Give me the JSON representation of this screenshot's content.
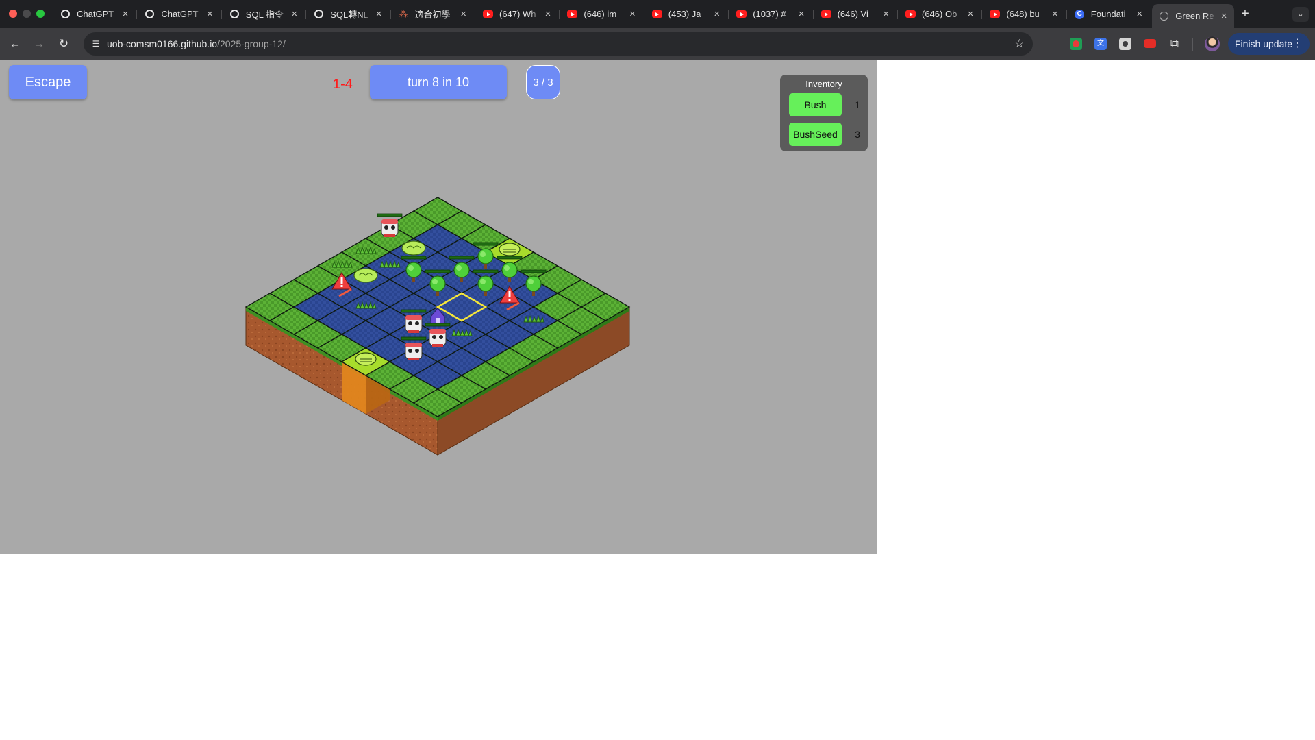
{
  "browser": {
    "tabs": [
      {
        "title": "ChatGPT",
        "icon": "chatgpt-icon"
      },
      {
        "title": "ChatGPT",
        "icon": "chatgpt-icon"
      },
      {
        "title": "SQL 指令",
        "icon": "chatgpt-icon"
      },
      {
        "title": "SQL轉NL",
        "icon": "chatgpt-icon"
      },
      {
        "title": "適合初學",
        "icon": "dots-icon"
      },
      {
        "title": "(647) Wh",
        "icon": "youtube-icon"
      },
      {
        "title": "(646) im",
        "icon": "youtube-icon"
      },
      {
        "title": "(453) Ja",
        "icon": "youtube-icon"
      },
      {
        "title": "(1037) #",
        "icon": "youtube-icon"
      },
      {
        "title": "(646) Vi",
        "icon": "youtube-icon"
      },
      {
        "title": "(646) Ob",
        "icon": "youtube-icon"
      },
      {
        "title": "(648) bu",
        "icon": "youtube-icon"
      },
      {
        "title": "Foundati",
        "icon": "c-icon"
      },
      {
        "title": "Green Re",
        "icon": "globe-icon",
        "active": true
      }
    ],
    "url_host": "uob-comsm0166.github.io",
    "url_path": "/2025-group-12/",
    "finish_update": "Finish update"
  },
  "game": {
    "escape_label": "Escape",
    "level": "1-4",
    "turn_label": "turn 8 in 10",
    "counter": "3 / 3",
    "inventory": {
      "title": "Inventory",
      "items": [
        {
          "name": "Bush",
          "count": "1"
        },
        {
          "name": "BushSeed",
          "count": "3"
        }
      ]
    },
    "colors": {
      "button": "#6e8bf5",
      "level_text": "#ff1a1a",
      "inventory_item": "#66f05a",
      "grass_tile": "#4a9a2a",
      "water_tile": "#2a4590",
      "lime_tile": "#a8dc2c"
    },
    "board": {
      "size": 8,
      "tiles": [
        "GGGLGGGG",
        "GBWBWBGG",
        "GWBWBWBG",
        "GBWBWBWG",
        "GWBWBWBG",
        "GBWBWBWG",
        "GWBWBWBG",
        "GGGGGGGG"
      ],
      "entities": [
        {
          "kind": "frog",
          "r": 0,
          "c": 3
        },
        {
          "kind": "frog",
          "r": 7,
          "c": 4
        },
        {
          "kind": "tree",
          "r": 1,
          "c": 3
        },
        {
          "kind": "tree",
          "r": 1,
          "c": 4
        },
        {
          "kind": "tree",
          "r": 1,
          "c": 5
        },
        {
          "kind": "tree",
          "r": 2,
          "c": 3
        },
        {
          "kind": "tree",
          "r": 2,
          "c": 4
        },
        {
          "kind": "tree",
          "r": 3,
          "c": 3
        },
        {
          "kind": "tree",
          "r": 3,
          "c": 2
        },
        {
          "kind": "bush",
          "r": 2,
          "c": 1
        },
        {
          "kind": "bush",
          "r": 4,
          "c": 1
        },
        {
          "kind": "warning",
          "r": 2,
          "c": 5
        },
        {
          "kind": "warning",
          "r": 5,
          "c": 1
        },
        {
          "kind": "house",
          "r": 4,
          "c": 4
        },
        {
          "kind": "robot",
          "r": 2,
          "c": 0
        },
        {
          "kind": "robot",
          "r": 5,
          "c": 4
        },
        {
          "kind": "robot",
          "r": 5,
          "c": 5
        },
        {
          "kind": "robot",
          "r": 6,
          "c": 5
        },
        {
          "kind": "grass",
          "r": 3,
          "c": 0
        },
        {
          "kind": "grass",
          "r": 4,
          "c": 0
        },
        {
          "kind": "grass",
          "r": 2,
          "c": 6
        },
        {
          "kind": "grass",
          "r": 4,
          "c": 5
        },
        {
          "kind": "grass",
          "r": 5,
          "c": 2
        },
        {
          "kind": "grass",
          "r": 3,
          "c": 1
        }
      ]
    }
  }
}
